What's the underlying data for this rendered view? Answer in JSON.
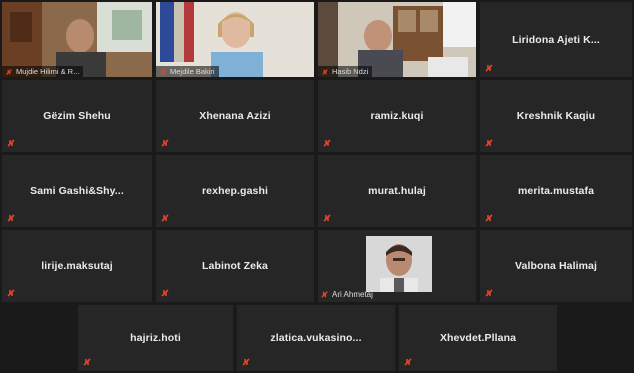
{
  "participants_video": [
    {
      "label": "Mujdie Hilimi & R..."
    },
    {
      "label": "Mejdile Bakiri"
    },
    {
      "label": "Hasib Ndzi"
    }
  ],
  "top_right_name": "Liridona Ajeti K...",
  "row2": [
    "Gëzim Shehu",
    "Xhenana Azizi",
    "ramiz.kuqi",
    "Kreshnik Kaqiu"
  ],
  "row3": [
    "Sami Gashi&Shy...",
    "rexhep.gashi",
    "murat.hulaj",
    "merita.mustafa"
  ],
  "row4": [
    "lirije.maksutaj",
    "Labinot Zeka",
    "Ari Ahmetaj",
    "Valbona Halimaj"
  ],
  "row5": [
    "hajriz.hoti",
    "zlatica.vukasino...",
    "Xhevdet.Pllana"
  ],
  "colors": {
    "mute_red": "#e0452b",
    "active_border": "#cfe34a",
    "tile_bg": "#262626"
  }
}
